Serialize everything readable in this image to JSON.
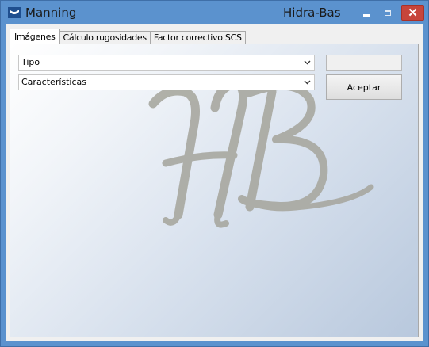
{
  "window": {
    "title": "Manning",
    "app_name": "Hidra-Bas",
    "close_glyph": "✕",
    "titlebar_color": "#5b92ce",
    "close_color": "#c7453b"
  },
  "tabs": [
    {
      "label": "Imágenes",
      "active": true
    },
    {
      "label": "Cálculo rugosidades",
      "active": false
    },
    {
      "label": "Factor correctivo SCS",
      "active": false
    }
  ],
  "form": {
    "tipo_combo": {
      "value": "Tipo"
    },
    "caracteristicas_combo": {
      "value": "Características"
    },
    "result_textbox": {
      "value": ""
    },
    "accept_button": {
      "label": "Aceptar"
    }
  },
  "watermark": {
    "text": "HB",
    "color": "#a8a8a0"
  },
  "icons": {
    "app": "app-logo-icon",
    "minimize": "minimize-icon",
    "maximize": "maximize-icon",
    "close": "close-icon",
    "dropdown": "chevron-down-icon"
  }
}
